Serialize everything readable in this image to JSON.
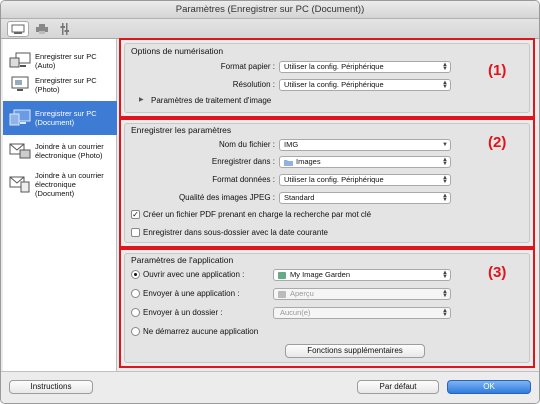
{
  "window": {
    "title": "Paramètres (Enregistrer sur PC (Document))"
  },
  "toolbar": {
    "icons": [
      "scan-icon",
      "printer-icon",
      "tools-icon"
    ]
  },
  "sidebar": {
    "items": [
      {
        "label": "Enregistrer sur PC (Auto)",
        "selected": false
      },
      {
        "label": "Enregistrer sur PC (Photo)",
        "selected": false
      },
      {
        "label": "Enregistrer sur PC (Document)",
        "selected": true
      },
      {
        "label": "Joindre à un courrier électronique (Photo)",
        "selected": false
      },
      {
        "label": "Joindre à un courrier électronique (Document)",
        "selected": false
      }
    ]
  },
  "section1": {
    "title": "Options de numérisation",
    "number": "(1)",
    "paper_label": "Format papier :",
    "paper_value": "Utiliser la config. Périphérique",
    "resolution_label": "Résolution :",
    "resolution_value": "Utiliser la config. Périphérique",
    "image_processing": "Paramètres de traitement d'image"
  },
  "section2": {
    "title": "Enregistrer les paramètres",
    "number": "(2)",
    "filename_label": "Nom du fichier :",
    "filename_value": "IMG",
    "savein_label": "Enregistrer dans :",
    "savein_value": "Images",
    "format_label": "Format données :",
    "format_value": "Utiliser la config. Périphérique",
    "jpeg_label": "Qualité des images JPEG :",
    "jpeg_value": "Standard",
    "pdf_search_label": "Créer un fichier PDF prenant en charge la recherche par mot clé",
    "pdf_search_checked": true,
    "subfolder_label": "Enregistrer dans sous-dossier avec la date courante",
    "subfolder_checked": false
  },
  "section3": {
    "title": "Paramètres de l'application",
    "number": "(3)",
    "open_app_label": "Ouvrir avec une application :",
    "open_app_value": "My Image Garden",
    "send_app_label": "Envoyer à une application :",
    "send_app_value": "Aperçu",
    "send_folder_label": "Envoyer à un dossier :",
    "send_folder_value": "Aucun(e)",
    "no_app_label": "Ne démarrez aucune application",
    "more_button": "Fonctions supplémentaires"
  },
  "footer": {
    "instructions": "Instructions",
    "defaults": "Par défaut",
    "ok": "OK"
  },
  "colors": {
    "highlight": "#e0141a",
    "selection": "#3d7bd4"
  }
}
